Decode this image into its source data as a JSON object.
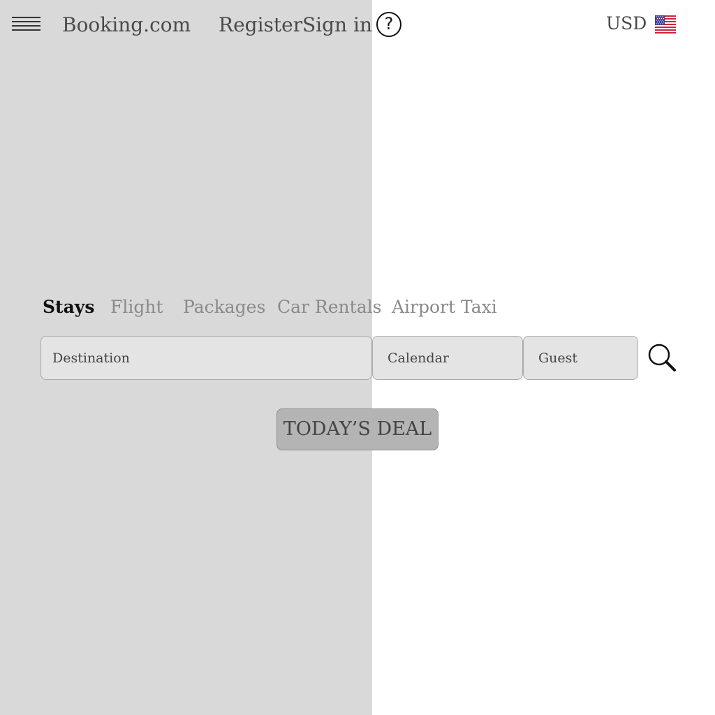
{
  "header": {
    "brand": "Booking.com",
    "register_label": "Register",
    "signin_label": "Sign in",
    "help_glyph": "?",
    "currency": "USD",
    "flag": "us-flag-icon"
  },
  "tabs": [
    {
      "label": "Stays",
      "active": true
    },
    {
      "label": "Flight",
      "active": false
    },
    {
      "label": "Packages",
      "active": false
    },
    {
      "label": "Car Rentals",
      "active": false
    },
    {
      "label": "Airport Taxi",
      "active": false
    }
  ],
  "search": {
    "destination_placeholder": "Destination",
    "calendar_placeholder": "Calendar",
    "guest_placeholder": "Guest"
  },
  "deal": {
    "label": "TODAY’S DEAL"
  },
  "colors": {
    "left_panel_bg": "#d9d9d9",
    "page_bg": "#ffffff",
    "field_bg": "#e4e4e4",
    "button_bg": "#b4b4b4"
  }
}
